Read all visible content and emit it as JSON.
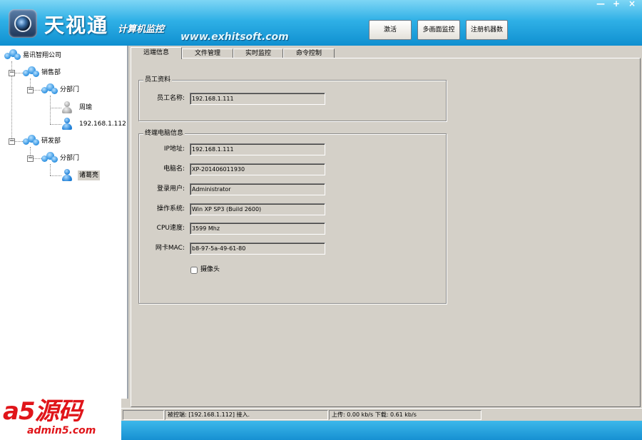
{
  "header": {
    "title": "天视通",
    "subtitle": "计算机监控",
    "website": "www.exhitsoft.com",
    "buttons": {
      "activate": "激活",
      "multi_screen": "多画面监控",
      "register": "注册机器数"
    },
    "window_controls": {
      "minimize": "—",
      "maximize": "+",
      "close": "×"
    }
  },
  "tree": {
    "root": "易讯智翔公司",
    "sales_dept": "销售部",
    "sales_branch": "分部门",
    "sales_user_1": "周瑜",
    "sales_user_2": "192.168.1.112",
    "rd_dept": "研发部",
    "rd_branch": "分部门",
    "rd_user_1": "诸葛亮"
  },
  "tabs": {
    "remote_info": "远端信息",
    "file_manage": "文件管理",
    "realtime_monitor": "实时监控",
    "command_control": "命令控制"
  },
  "employee_group": {
    "title": "员工资料",
    "name_label": "员工名称:",
    "name_value": "192.168.1.111"
  },
  "terminal_group": {
    "title": "终端电脑信息",
    "ip_label": "IP地址:",
    "ip_value": "192.168.1.111",
    "pcname_label": "电脑名:",
    "pcname_value": "XP-201406011930",
    "user_label": "登录用户:",
    "user_value": "Administrator",
    "os_label": "操作系统:",
    "os_value": "Win XP SP3 (Build 2600)",
    "cpu_label": "CPU速度:",
    "cpu_value": "3599 Mhz",
    "mac_label": "网卡MAC:",
    "mac_value": "b8-97-5a-49-61-80",
    "camera_label": "摄像头"
  },
  "status_bar": {
    "cell1": "",
    "cell2": "被控端: [192.168.1.112] 接入.",
    "cell3": "上传: 0.00 kb/s 下载: 0.61 kb/s"
  },
  "watermark": {
    "logo": "a5源码",
    "url": "admin5.com"
  },
  "colors": {
    "header_blue": "#2fb0e6",
    "watermark_red": "#e0151a"
  }
}
